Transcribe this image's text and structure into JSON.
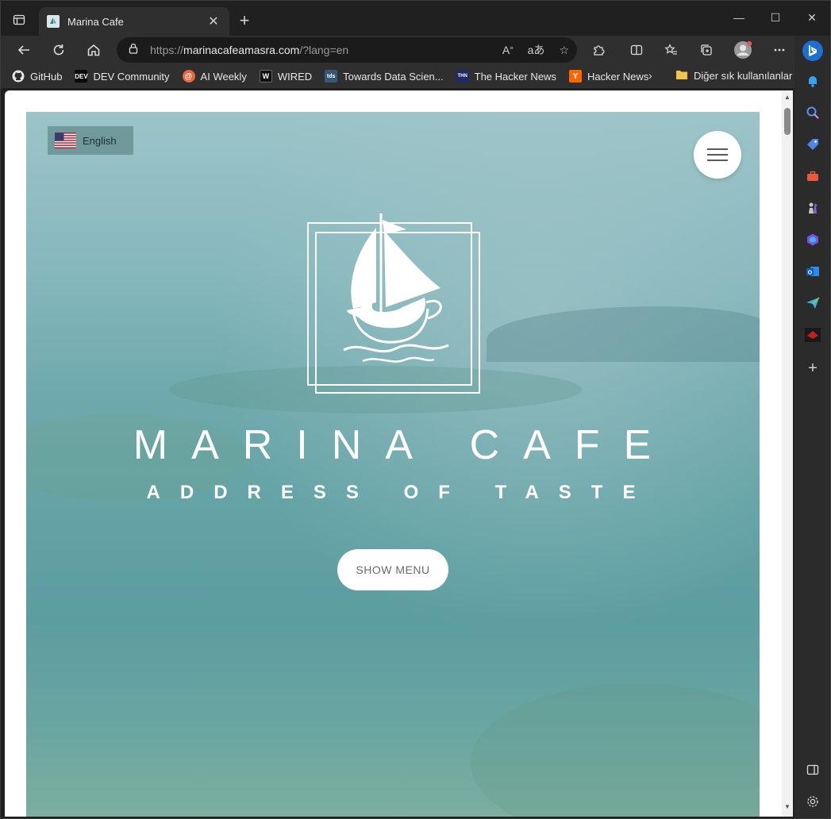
{
  "browser": {
    "tab_title": "Marina Cafe",
    "url_scheme": "https://",
    "url_host": "marinacafeamasra.com",
    "url_path": "/?lang=en",
    "bookmarks": [
      {
        "label": "GitHub",
        "icon": "github-icon"
      },
      {
        "label": "DEV Community",
        "icon": "dev-icon"
      },
      {
        "label": "AI Weekly",
        "icon": "ai-weekly-icon"
      },
      {
        "label": "WIRED",
        "icon": "wired-icon"
      },
      {
        "label": "Towards Data Scien...",
        "icon": "tds-icon"
      },
      {
        "label": "The Hacker News",
        "icon": "thn-icon"
      },
      {
        "label": "Hacker News",
        "icon": "ycombinator-icon"
      }
    ],
    "other_favorites": "Diğer sık kullanılanlar"
  },
  "page": {
    "language": "English",
    "title": "MARINA CAFE",
    "subtitle": "ADDRESS OF TASTE",
    "cta": "SHOW MENU"
  },
  "colors": {
    "hero_tint": "#64a3a6",
    "browser_chrome": "#2f2f2f"
  }
}
